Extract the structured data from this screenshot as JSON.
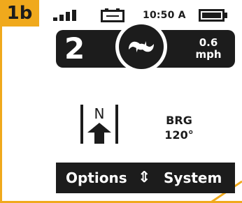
{
  "step": {
    "label": "1b"
  },
  "status": {
    "time": "10:50 A",
    "signal_icon": "signal-bars-icon",
    "battery_small_icon": "battery-icon",
    "battery_large_icon": "battery-full-icon"
  },
  "info_bar": {
    "satellite_count": "2",
    "mode_icon": "spot-lock-icon",
    "speed_value": "0.6",
    "speed_unit": "mph"
  },
  "compass": {
    "letter": "N",
    "icon": "north-arrow-icon"
  },
  "bearing": {
    "label": "BRG",
    "value": "120°"
  },
  "menu": {
    "left_label": "Options",
    "arrows": "⇕",
    "right_label": "System"
  },
  "colors": {
    "accent": "#f0a91c",
    "dark": "#1c1c1c",
    "background": "#ffffff"
  }
}
